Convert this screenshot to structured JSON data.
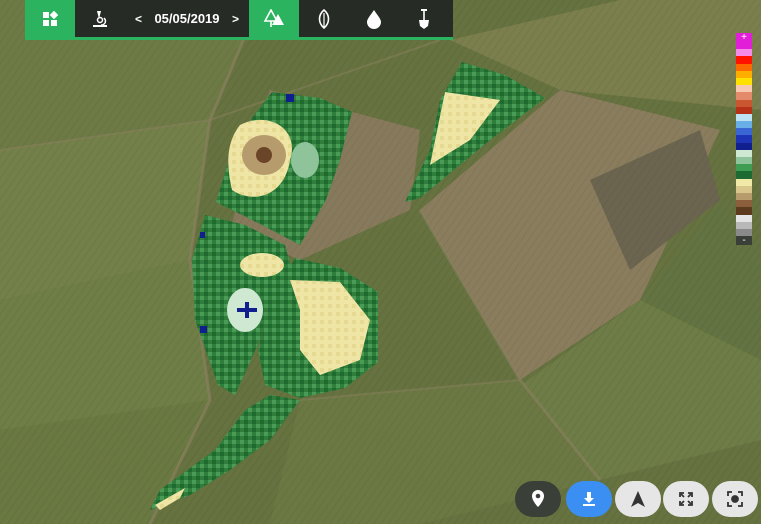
{
  "toolbar": {
    "date": "05/05/2019",
    "prev_label": "<",
    "next_label": ">",
    "items": [
      {
        "icon": "dashboard-icon"
      },
      {
        "icon": "microscope-icon"
      },
      {
        "icon": "trees-icon"
      },
      {
        "icon": "leaf-icon"
      },
      {
        "icon": "water-drop-icon"
      },
      {
        "icon": "soil-shovel-icon"
      }
    ],
    "active_color": "#2cb35f"
  },
  "legend": {
    "top_label": "+",
    "bottom_label": "-",
    "colors": [
      "#e21ed8",
      "#f58ae7",
      "#ff1200",
      "#ff6a00",
      "#ffae00",
      "#ffe100",
      "#f6c9b0",
      "#e38a6a",
      "#c95631",
      "#b53219",
      "#bde2f4",
      "#6aaee8",
      "#3a66d4",
      "#1c34b5",
      "#101f8d",
      "#cfe8d2",
      "#8fc49a",
      "#3e9d53",
      "#1d6a32",
      "#f1e9a8",
      "#d8c68a",
      "#b69b6d",
      "#8b5e3c",
      "#5c3a1e",
      "#e4e4e4",
      "#b8b8b8",
      "#8a8a8a"
    ]
  },
  "map_controls": [
    {
      "icon": "location-pin-icon"
    },
    {
      "icon": "download-icon"
    },
    {
      "icon": "navigation-arrow-icon"
    },
    {
      "icon": "fullscreen-icon"
    },
    {
      "icon": "focus-target-icon"
    }
  ]
}
